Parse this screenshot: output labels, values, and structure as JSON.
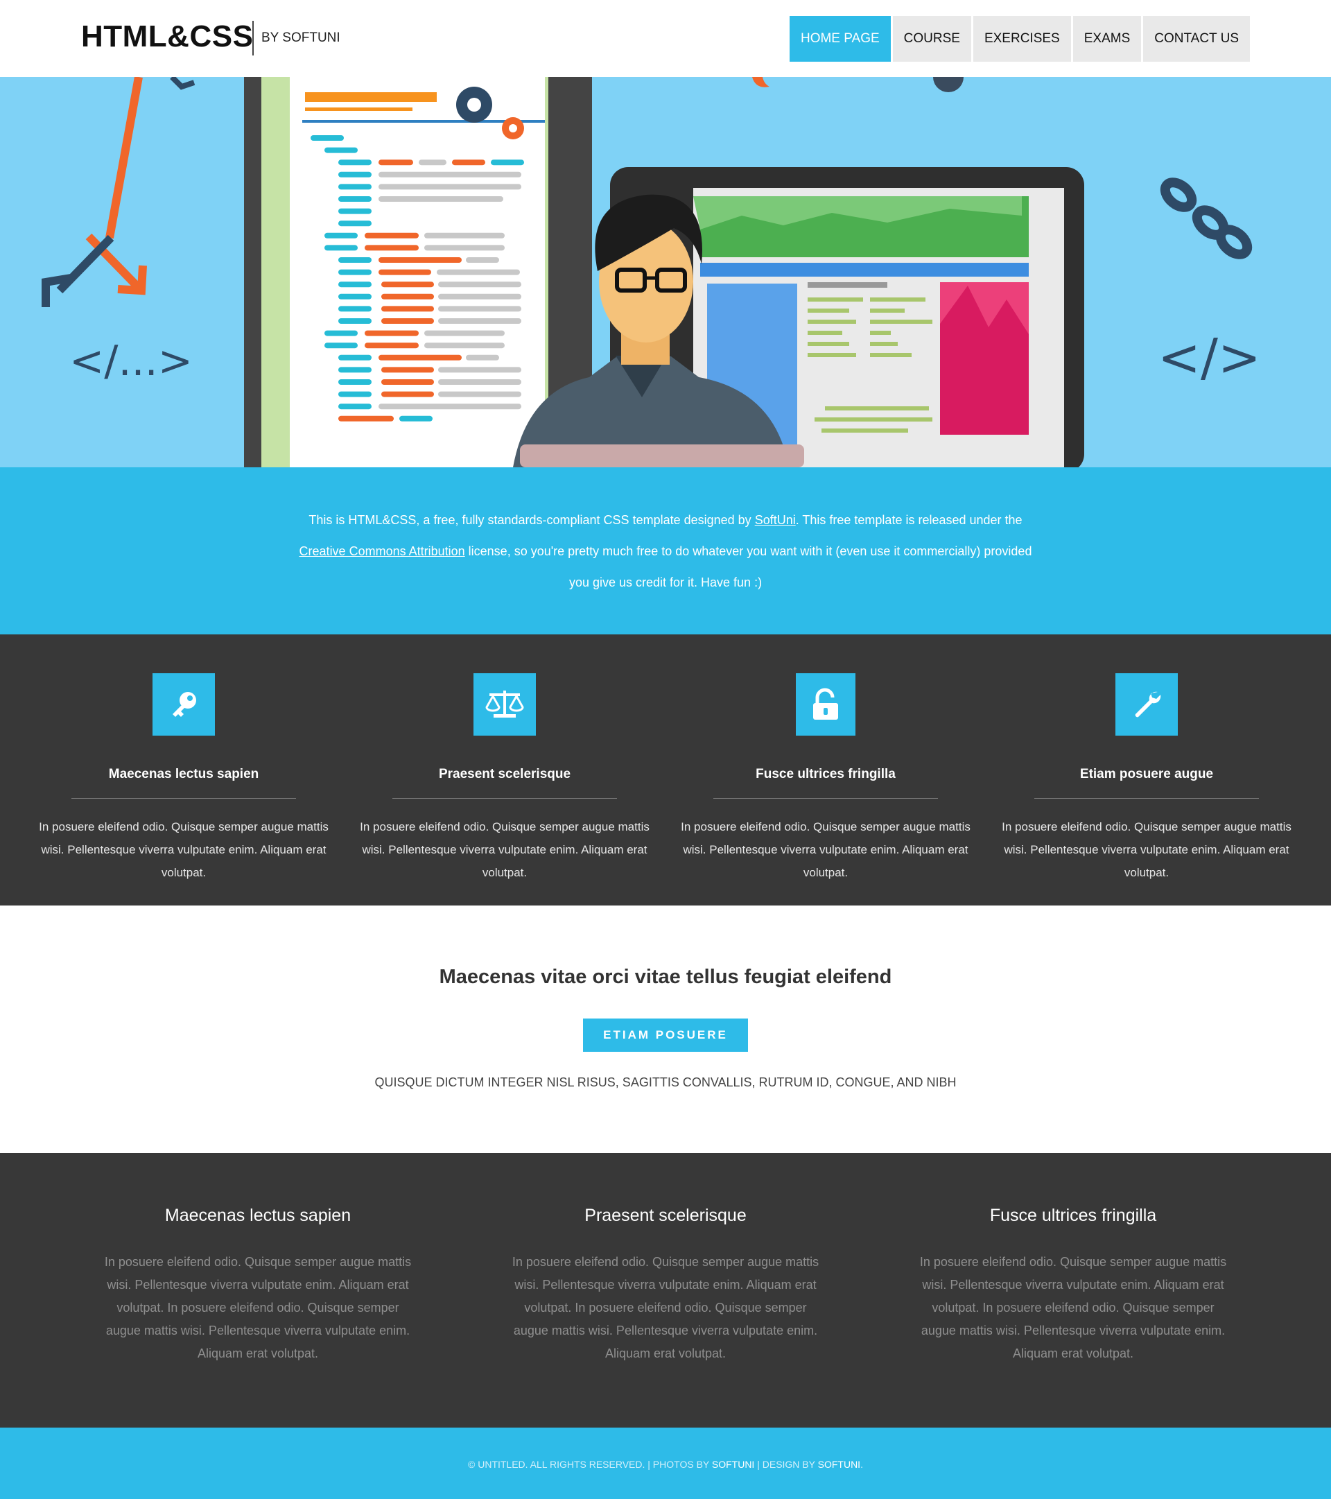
{
  "header": {
    "logo": "HTML&CSS",
    "logo_sub": "BY SOFTUNI",
    "nav": [
      {
        "label": "HOME PAGE",
        "active": true
      },
      {
        "label": "COURSE",
        "active": false
      },
      {
        "label": "EXERCISES",
        "active": false
      },
      {
        "label": "EXAMS",
        "active": false
      },
      {
        "label": "CONTACT US",
        "active": false
      }
    ]
  },
  "hero": {
    "left_code_tag": "</...>",
    "right_code_tag": "</>"
  },
  "intro": {
    "part1": "This is HTML&CSS, a free, fully standards-compliant CSS template designed by ",
    "link1": "SoftUni",
    "part2": ". This free template is released under the ",
    "link2": "Creative Commons Attribution",
    "part3": " license, so you're pretty much free to do whatever you want with it (even use it commercially) provided you give us credit for it. Have fun :)"
  },
  "features": [
    {
      "icon": "key-icon",
      "title": "Maecenas lectus sapien",
      "text": "In posuere eleifend odio. Quisque semper augue mattis wisi. Pellentesque viverra vulputate enim. Aliquam erat volutpat."
    },
    {
      "icon": "scales-icon",
      "title": "Praesent scelerisque",
      "text": "In posuere eleifend odio. Quisque semper augue mattis wisi. Pellentesque viverra vulputate enim. Aliquam erat volutpat."
    },
    {
      "icon": "unlock-icon",
      "title": "Fusce ultrices fringilla",
      "text": "In posuere eleifend odio. Quisque semper augue mattis wisi. Pellentesque viverra vulputate enim. Aliquam erat volutpat."
    },
    {
      "icon": "wrench-icon",
      "title": "Etiam posuere augue",
      "text": "In posuere eleifend odio. Quisque semper augue mattis wisi. Pellentesque viverra vulputate enim. Aliquam erat volutpat."
    }
  ],
  "cta": {
    "title": "Maecenas vitae orci vitae tellus feugiat eleifend",
    "button": "ETIAM POSUERE",
    "subtitle": "QUISQUE DICTUM INTEGER NISL RISUS, SAGITTIS CONVALLIS, RUTRUM ID, CONGUE, AND NIBH"
  },
  "columns": [
    {
      "title": "Maecenas lectus sapien",
      "text": "In posuere eleifend odio. Quisque semper augue mattis wisi. Pellentesque viverra vulputate enim. Aliquam erat volutpat. In posuere eleifend odio. Quisque semper augue mattis wisi. Pellentesque viverra vulputate enim. Aliquam erat volutpat."
    },
    {
      "title": "Praesent scelerisque",
      "text": "In posuere eleifend odio. Quisque semper augue mattis wisi. Pellentesque viverra vulputate enim. Aliquam erat volutpat. In posuere eleifend odio. Quisque semper augue mattis wisi. Pellentesque viverra vulputate enim. Aliquam erat volutpat."
    },
    {
      "title": "Fusce ultrices fringilla",
      "text": "In posuere eleifend odio. Quisque semper augue mattis wisi. Pellentesque viverra vulputate enim. Aliquam erat volutpat. In posuere eleifend odio. Quisque semper augue mattis wisi. Pellentesque viverra vulputate enim. Aliquam erat volutpat."
    }
  ],
  "footer": {
    "copyright": "© UNTITLED. ALL RIGHTS RESERVED. | PHOTOS BY ",
    "photos_link": "SOFTUNI",
    "design_text": " | DESIGN BY ",
    "design_link": "SOFTUNI",
    "end": "."
  },
  "colors": {
    "accent": "#2ebbe8",
    "hero_bg": "#7fd2f6",
    "dark": "#383838"
  }
}
